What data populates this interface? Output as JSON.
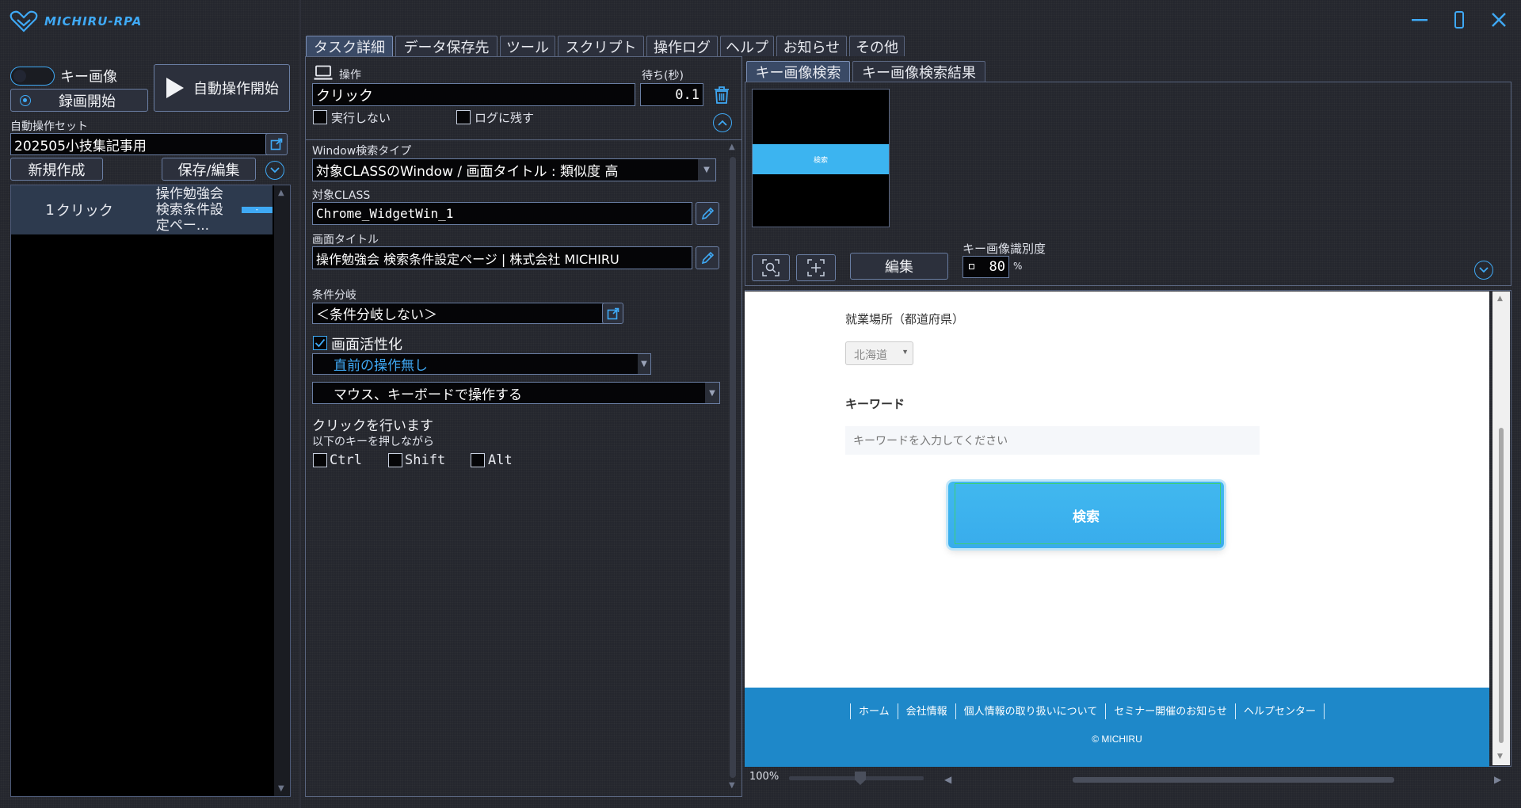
{
  "app": {
    "title": "MICHIRU-RPA"
  },
  "left": {
    "key_image_label": "キー画像",
    "record_label": "録画開始",
    "run_label": "自動操作開始",
    "set_label": "自動操作セット",
    "set_value": "202505小技集記事用",
    "new_label": "新規作成",
    "save_label": "保存/編集",
    "rows": [
      {
        "index": "1",
        "action": "クリック",
        "desc": "操作勉強会 検索条件設定ペー...",
        "badge": "-"
      }
    ]
  },
  "tabs": [
    {
      "label": "タスク詳細"
    },
    {
      "label": "データ保存先"
    },
    {
      "label": "ツール"
    },
    {
      "label": "スクリプト"
    },
    {
      "label": "操作ログ"
    },
    {
      "label": "ヘルプ"
    },
    {
      "label": "お知らせ"
    },
    {
      "label": "その他"
    }
  ],
  "task": {
    "op_label": "操作",
    "op_value": "クリック",
    "wait_label": "待ち(秒)",
    "wait_value": "0.1",
    "no_exec_label": "実行しない",
    "log_label": "ログに残す",
    "window_type_label": "Window検索タイプ",
    "window_type_value": "対象CLASSのWindow / 画面タイトル : 類似度 高",
    "class_label": "対象CLASS",
    "class_value": "Chrome_WidgetWin_1",
    "title_label": "画面タイトル",
    "title_value": "操作勉強会 検索条件設定ページ | 株式会社 MICHIRU",
    "branch_label": "条件分岐",
    "branch_value": "＜条件分岐しない＞",
    "activate_label": "画面活性化",
    "prev_op_value": "直前の操作無し",
    "mode_value": "マウス、キーボードで操作する",
    "desc1": "クリックを行います",
    "desc2": "以下のキーを押しながら",
    "mod_ctrl": "Ctrl",
    "mod_shift": "Shift",
    "mod_alt": "Alt"
  },
  "key_image": {
    "tab_search": "キー画像検索",
    "tab_result": "キー画像検索結果",
    "thumb_text": "検索",
    "edit_label": "編集",
    "sensitivity_label": "キー画像識別度",
    "sensitivity_value": "80",
    "percent": "%"
  },
  "preview": {
    "place_label": "就業場所（都道府県）",
    "pref_value": "北海道",
    "keyword_label": "キーワード",
    "keyword_placeholder": "キーワードを入力してください",
    "search_button": "検索",
    "footer_links": [
      "ホーム",
      "会社情報",
      "個人情報の取り扱いについて",
      "セミナー開催のお知らせ",
      "ヘルプセンター"
    ],
    "copyright": "© MICHIRU",
    "zoom": "100%"
  },
  "colors": {
    "accent": "#3fa9f5",
    "background": "#23252c",
    "footer": "#1e88c9"
  }
}
